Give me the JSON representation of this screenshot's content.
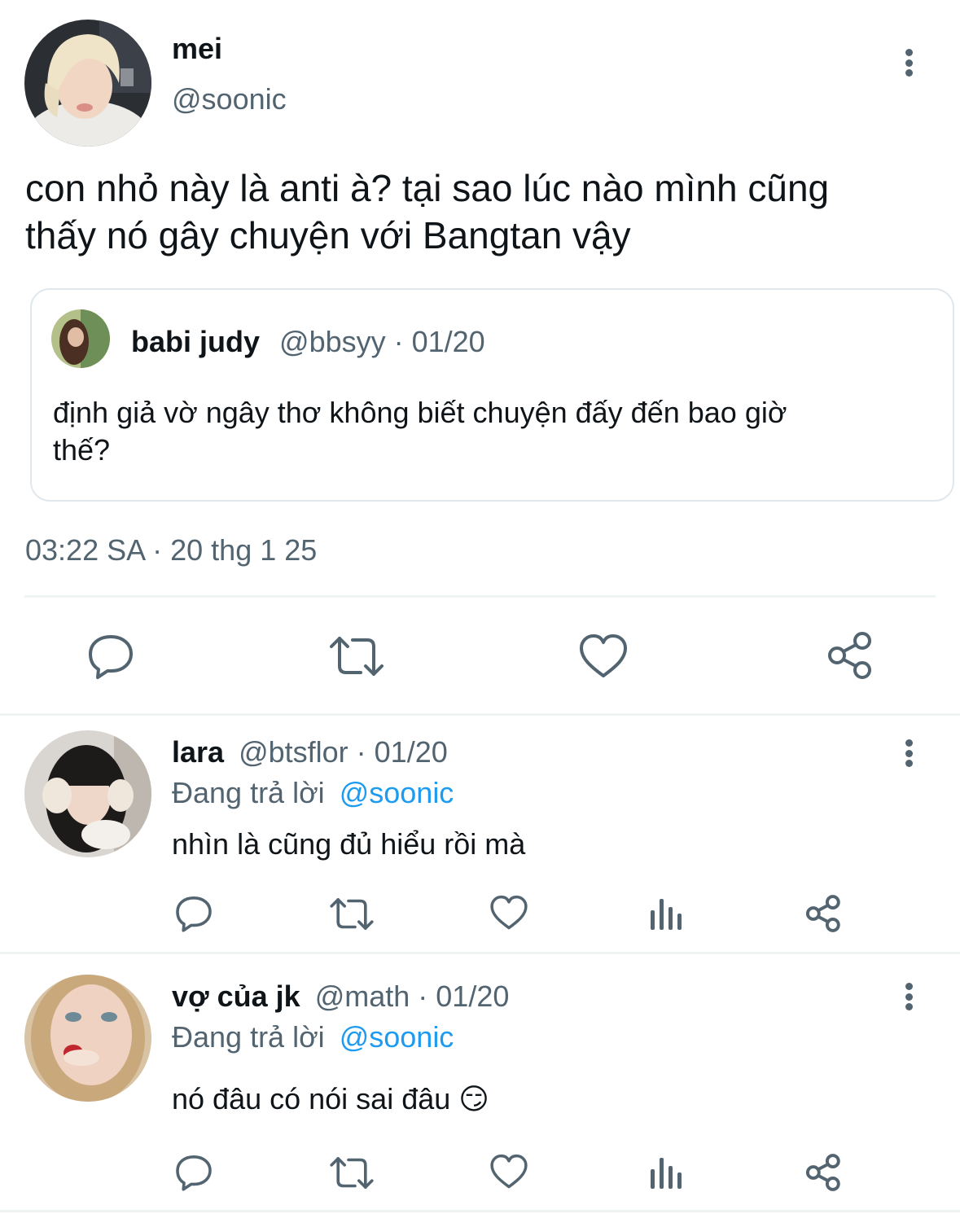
{
  "main_tweet": {
    "name": "mei",
    "handle": "@soonic",
    "text_line1": "con nhỏ này là anti à? tại sao lúc nào mình cũng",
    "text_line2": "thấy nó gây chuyện với Bangtan vậy",
    "timestamp": "03:22 SA · 20 thg 1 25",
    "quoted": {
      "name": "babi judy",
      "handle_date": "@bbsyy · 01/20",
      "text_line1": "định giả vờ ngây thơ không biết chuyện đấy đến bao giờ",
      "text_line2": "thế?"
    }
  },
  "replies": [
    {
      "name": "lara",
      "handle_date": "@btsflor · 01/20",
      "replying_prefix": "Đang trả lời",
      "replying_to": "@soonic",
      "text": "nhìn là cũng đủ hiểu rồi mà"
    },
    {
      "name": "vợ của jk",
      "handle_date": "@math · 01/20",
      "replying_prefix": "Đang trả lời",
      "replying_to": "@soonic",
      "text": "nó đâu có nói sai đâu 😏"
    }
  ],
  "icons": {
    "reply": "reply-icon",
    "retweet": "retweet-icon",
    "like": "heart-icon",
    "views": "views-icon",
    "share": "share-icon",
    "more": "more-vertical-icon"
  },
  "colors": {
    "text": "#0f1419",
    "muted": "#536471",
    "link": "#1d9bf0",
    "divider": "#eff3f4"
  }
}
